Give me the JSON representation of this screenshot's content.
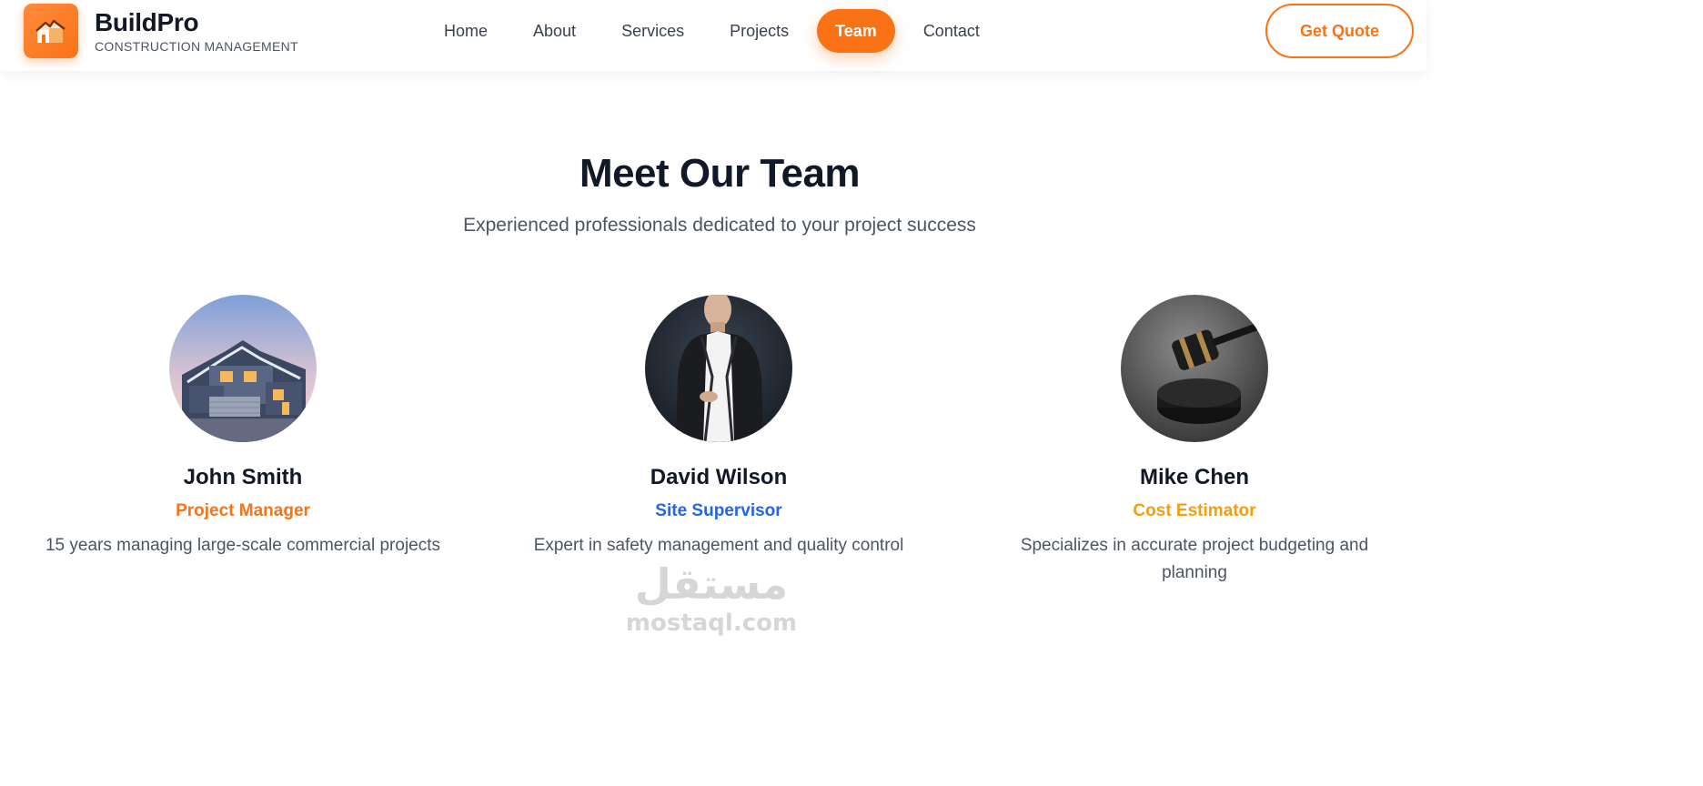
{
  "brand": {
    "name": "BuildPro",
    "tagline": "CONSTRUCTION MANAGEMENT",
    "logo_icon": "building-icon",
    "accent_color": "#f97316"
  },
  "nav": {
    "links": [
      {
        "label": "Home",
        "active": false
      },
      {
        "label": "About",
        "active": false
      },
      {
        "label": "Services",
        "active": false
      },
      {
        "label": "Projects",
        "active": false
      },
      {
        "label": "Team",
        "active": true
      },
      {
        "label": "Contact",
        "active": false
      }
    ],
    "cta_label": "Get Quote"
  },
  "team": {
    "title": "Meet Our Team",
    "subtitle": "Experienced professionals dedicated to your project success",
    "members": [
      {
        "name": "John Smith",
        "role": "Project Manager",
        "role_color": "#f97316",
        "description": "15 years managing large-scale commercial projects",
        "photo": "house-photo"
      },
      {
        "name": "David Wilson",
        "role": "Site Supervisor",
        "role_color": "#2563eb",
        "description": "Expert in safety management and quality control",
        "photo": "man-in-suit-photo"
      },
      {
        "name": "Mike Chen",
        "role": "Cost Estimator",
        "role_color": "#f59e0b",
        "description": "Specializes in accurate project budgeting and planning",
        "photo": "gavel-photo"
      }
    ]
  },
  "watermark": {
    "arabic": "مستقل",
    "latin": "mostaql.com"
  }
}
